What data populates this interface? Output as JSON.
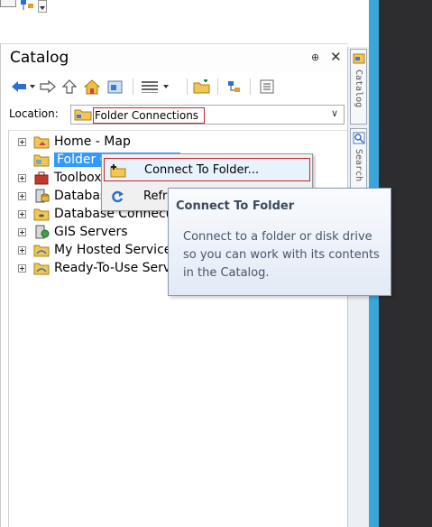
{
  "panel": {
    "title": "Catalog",
    "pin_glyph": "⊕",
    "close_glyph": "✕"
  },
  "location": {
    "label": "Location:",
    "value": "Folder Connections",
    "dropdown_glyph": "∨"
  },
  "toolbar": {
    "icons": [
      "back-arrow-icon",
      "dropdown-arrow-icon",
      "forward-arrow-icon",
      "up-one-level-icon",
      "home-icon",
      "toggle-contents-icon",
      "view-options-icon",
      "connect-folder-icon",
      "disconnect-folder-icon",
      "options-icon"
    ]
  },
  "tree": {
    "items": [
      {
        "label": "Home - Map",
        "icon": "home-folder-icon",
        "expander": true
      },
      {
        "label": "Folder Connections",
        "icon": "folder-connections-icon",
        "expander": false,
        "selected": true
      },
      {
        "label": "Toolboxes",
        "icon": "toolbox-icon",
        "expander": true
      },
      {
        "label": "Database Servers",
        "icon": "database-server-icon",
        "expander": true
      },
      {
        "label": "Database Connections",
        "icon": "database-connections-icon",
        "expander": true
      },
      {
        "label": "GIS Servers",
        "icon": "gis-servers-icon",
        "expander": true
      },
      {
        "label": "My Hosted Services",
        "icon": "hosted-services-icon",
        "expander": true
      },
      {
        "label": "Ready-To-Use Services",
        "icon": "ready-services-icon",
        "expander": true
      }
    ]
  },
  "dock": {
    "tabs": [
      {
        "label": "Catalog"
      },
      {
        "label": "Search"
      }
    ]
  },
  "context_menu": {
    "items": [
      {
        "label": "Connect To Folder...",
        "icon": "connect-folder-icon"
      },
      {
        "label": "Refresh",
        "icon": "refresh-icon"
      }
    ]
  },
  "tooltip": {
    "title": "Connect To Folder",
    "body": "Connect to a folder or disk drive so you can work with its contents in the Catalog."
  },
  "colors": {
    "selection": "#3399ff",
    "highlight_border": "#c0282d",
    "side_bar_blue": "#3aa6d9",
    "dark_background": "#2d2d30"
  }
}
